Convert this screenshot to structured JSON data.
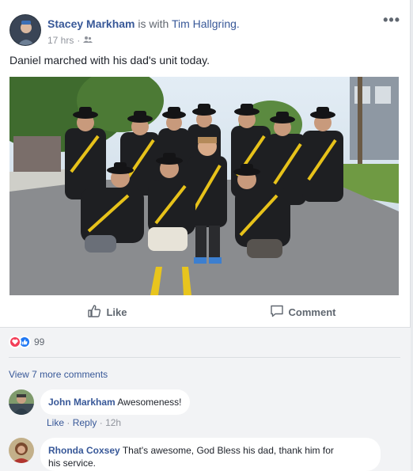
{
  "post": {
    "author": "Stacey Markham",
    "with_text": "is with",
    "tagged": "Tim Hallgring.",
    "time": "17 hrs",
    "audience_icon": "friends-icon",
    "more_icon": "more-options-icon",
    "text": "Daniel marched with his dad's unit today."
  },
  "actions": {
    "like_label": "Like",
    "comment_label": "Comment"
  },
  "reactions": {
    "icons": [
      "heart-icon",
      "like-icon"
    ],
    "count": "99"
  },
  "comments": {
    "view_more": "View 7 more comments",
    "items": [
      {
        "author": "John Markham",
        "text": "Awesomeness!",
        "like_label": "Like",
        "reply_label": "Reply",
        "time": "12h"
      },
      {
        "author": "Rhonda Coxsey",
        "text_line1": "That's awesome, God Bless his dad, thank him for",
        "text_line2": "his service."
      }
    ]
  },
  "colors": {
    "link": "#385898",
    "meta": "#90949c",
    "heart": "#f33e58",
    "like": "#2078f4"
  }
}
